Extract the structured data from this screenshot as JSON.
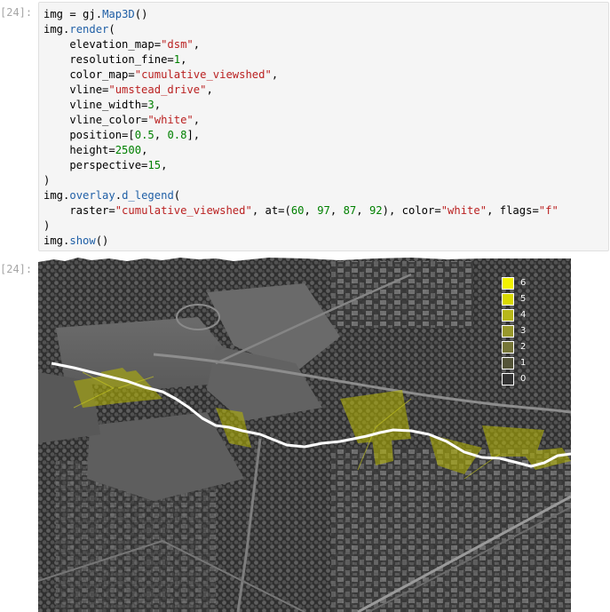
{
  "input_cell": {
    "prompt": "[24]:",
    "code_lines": [
      [
        {
          "t": "img",
          "c": "var"
        },
        {
          "t": " = ",
          "c": "op"
        },
        {
          "t": "gj",
          "c": "var"
        },
        {
          "t": ".",
          "c": "op"
        },
        {
          "t": "Map3D",
          "c": "fn"
        },
        {
          "t": "()",
          "c": "op"
        }
      ],
      [
        {
          "t": "img",
          "c": "var"
        },
        {
          "t": ".",
          "c": "op"
        },
        {
          "t": "render",
          "c": "fn"
        },
        {
          "t": "(",
          "c": "op"
        }
      ],
      [
        {
          "t": "    elevation_map=",
          "c": "var"
        },
        {
          "t": "\"dsm\"",
          "c": "str"
        },
        {
          "t": ",",
          "c": "op"
        }
      ],
      [
        {
          "t": "    resolution_fine=",
          "c": "var"
        },
        {
          "t": "1",
          "c": "num"
        },
        {
          "t": ",",
          "c": "op"
        }
      ],
      [
        {
          "t": "    color_map=",
          "c": "var"
        },
        {
          "t": "\"cumulative_viewshed\"",
          "c": "str"
        },
        {
          "t": ",",
          "c": "op"
        }
      ],
      [
        {
          "t": "    vline=",
          "c": "var"
        },
        {
          "t": "\"umstead_drive\"",
          "c": "str"
        },
        {
          "t": ",",
          "c": "op"
        }
      ],
      [
        {
          "t": "    vline_width=",
          "c": "var"
        },
        {
          "t": "3",
          "c": "num"
        },
        {
          "t": ",",
          "c": "op"
        }
      ],
      [
        {
          "t": "    vline_color=",
          "c": "var"
        },
        {
          "t": "\"white\"",
          "c": "str"
        },
        {
          "t": ",",
          "c": "op"
        }
      ],
      [
        {
          "t": "    position=[",
          "c": "var"
        },
        {
          "t": "0.5",
          "c": "num"
        },
        {
          "t": ", ",
          "c": "op"
        },
        {
          "t": "0.8",
          "c": "num"
        },
        {
          "t": "],",
          "c": "op"
        }
      ],
      [
        {
          "t": "    height=",
          "c": "var"
        },
        {
          "t": "2500",
          "c": "num"
        },
        {
          "t": ",",
          "c": "op"
        }
      ],
      [
        {
          "t": "    perspective=",
          "c": "var"
        },
        {
          "t": "15",
          "c": "num"
        },
        {
          "t": ",",
          "c": "op"
        }
      ],
      [
        {
          "t": ")",
          "c": "op"
        }
      ],
      [
        {
          "t": "img",
          "c": "var"
        },
        {
          "t": ".",
          "c": "op"
        },
        {
          "t": "overlay",
          "c": "fn"
        },
        {
          "t": ".",
          "c": "op"
        },
        {
          "t": "d_legend",
          "c": "fn"
        },
        {
          "t": "(",
          "c": "op"
        }
      ],
      [
        {
          "t": "    raster=",
          "c": "var"
        },
        {
          "t": "\"cumulative_viewshed\"",
          "c": "str"
        },
        {
          "t": ", at=(",
          "c": "op"
        },
        {
          "t": "60",
          "c": "num"
        },
        {
          "t": ", ",
          "c": "op"
        },
        {
          "t": "97",
          "c": "num"
        },
        {
          "t": ", ",
          "c": "op"
        },
        {
          "t": "87",
          "c": "num"
        },
        {
          "t": ", ",
          "c": "op"
        },
        {
          "t": "92",
          "c": "num"
        },
        {
          "t": "), color=",
          "c": "op"
        },
        {
          "t": "\"white\"",
          "c": "str"
        },
        {
          "t": ", flags=",
          "c": "op"
        },
        {
          "t": "\"f\"",
          "c": "str"
        }
      ],
      [
        {
          "t": ")",
          "c": "op"
        }
      ],
      [
        {
          "t": "img",
          "c": "var"
        },
        {
          "t": ".",
          "c": "op"
        },
        {
          "t": "show",
          "c": "fn"
        },
        {
          "t": "()",
          "c": "op"
        }
      ]
    ]
  },
  "output_cell": {
    "prompt": "[24]:",
    "legend": [
      {
        "label": "6",
        "color": "#f2f200"
      },
      {
        "label": "5",
        "color": "#d9d900"
      },
      {
        "label": "4",
        "color": "#b7b71a"
      },
      {
        "label": "3",
        "color": "#98982c"
      },
      {
        "label": "2",
        "color": "#767638"
      },
      {
        "label": "1",
        "color": "#545438"
      },
      {
        "label": "0",
        "color": "#333333"
      }
    ]
  }
}
